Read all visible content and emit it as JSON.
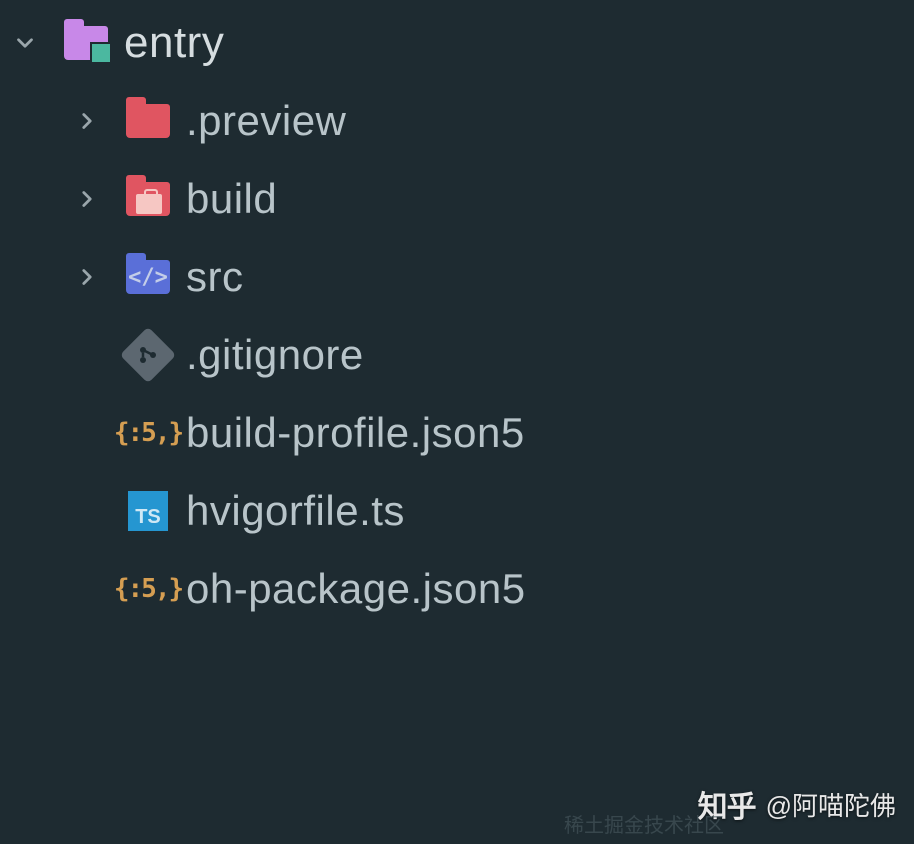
{
  "root": {
    "label": "entry",
    "expanded": true
  },
  "children": [
    {
      "label": ".preview",
      "type": "folder-red",
      "expandable": true
    },
    {
      "label": "build",
      "type": "folder-red-briefcase",
      "expandable": true
    },
    {
      "label": "src",
      "type": "folder-blue-code",
      "expandable": true
    },
    {
      "label": ".gitignore",
      "type": "git",
      "expandable": false
    },
    {
      "label": "build-profile.json5",
      "type": "json5",
      "expandable": false
    },
    {
      "label": "hvigorfile.ts",
      "type": "ts",
      "expandable": false
    },
    {
      "label": "oh-package.json5",
      "type": "json5",
      "expandable": false
    }
  ],
  "json5_icon_text": "{:5,}",
  "ts_icon_text": "TS",
  "watermark": {
    "logo": "知乎",
    "user": "@阿喵陀佛",
    "community": "稀土掘金技术社区"
  }
}
